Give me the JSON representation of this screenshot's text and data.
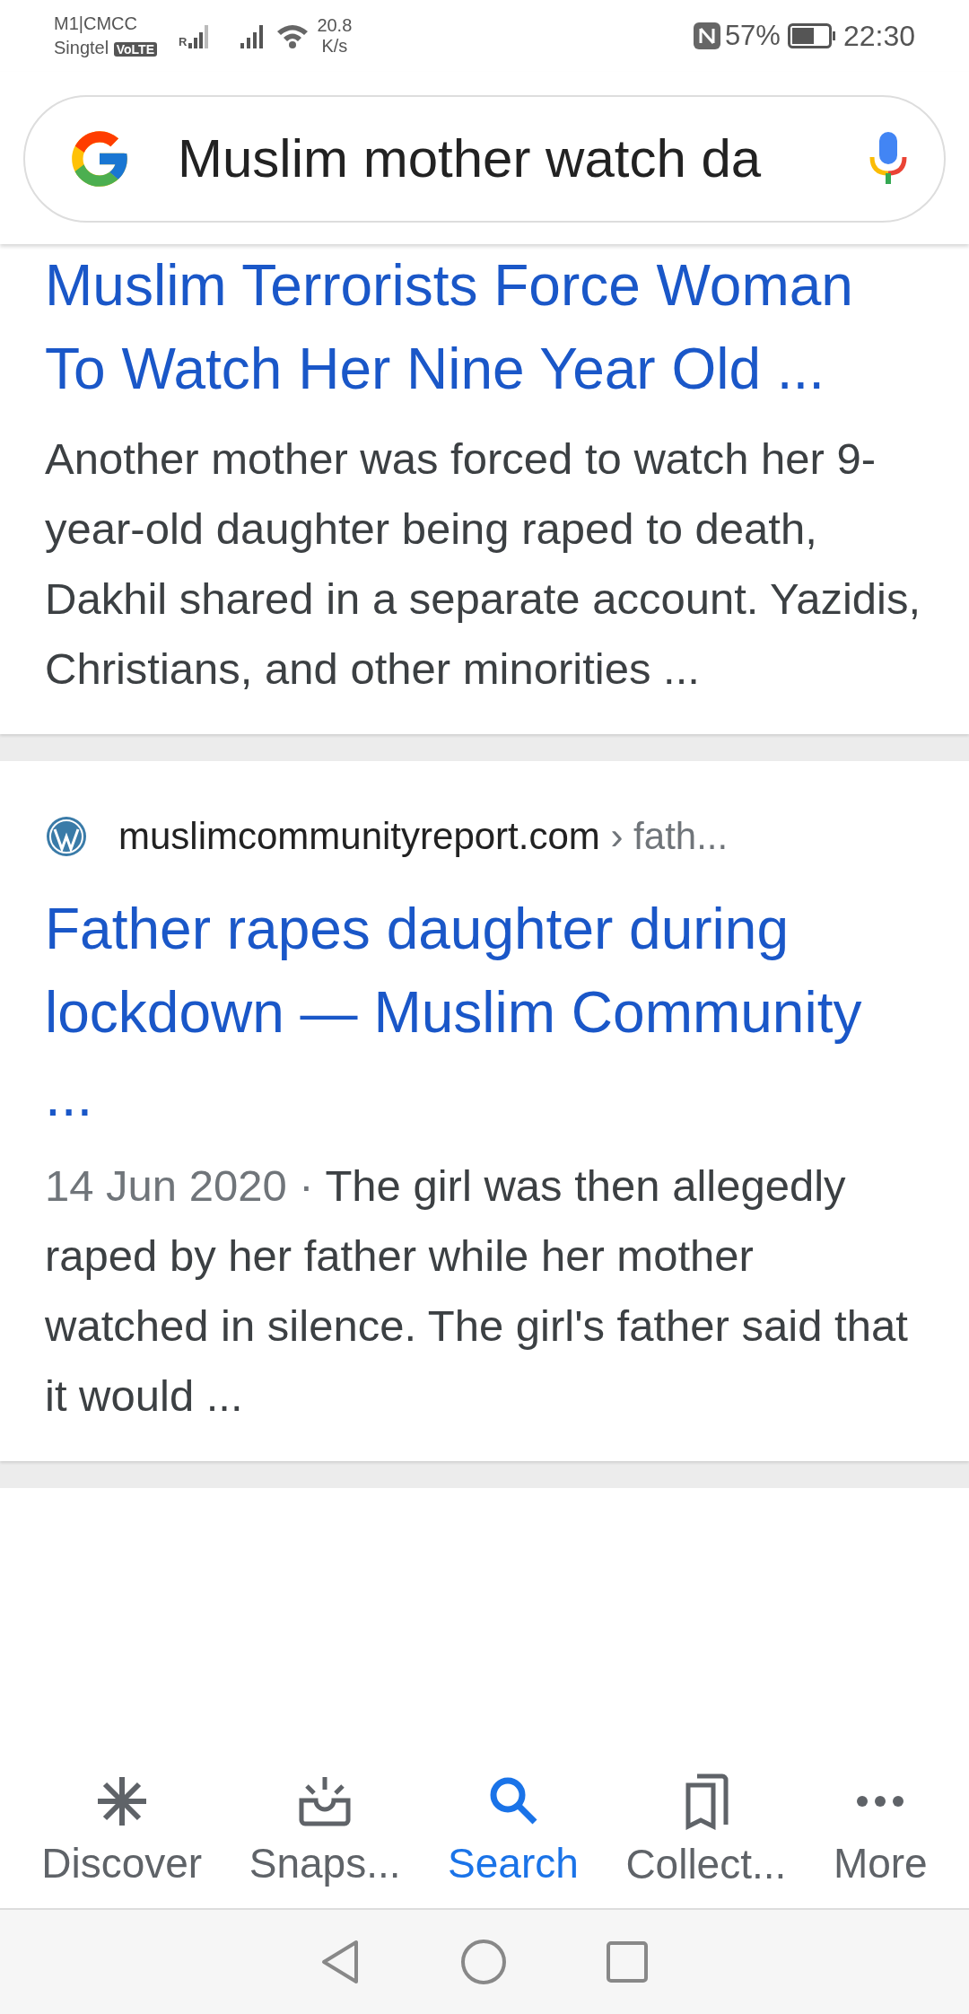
{
  "status_bar": {
    "carrier_1": "M1|CMCC",
    "carrier_2": "Singtel",
    "volte": "VoLTE",
    "roaming": "R",
    "speed_value": "20.8",
    "speed_unit": "K/s",
    "battery": "57%",
    "time": "22:30"
  },
  "search": {
    "value": "Muslim mother watch da"
  },
  "results": [
    {
      "kind": "plain",
      "title": "Muslim Terrorists Force Woman To Watch Her Nine Year Old ...",
      "snippet": "Another mother was forced to watch her 9-year-old daughter being raped to death, Dakhil shared in a separate account. Yazidis, Christians, and other minorities ..."
    },
    {
      "kind": "sourced",
      "site": "muslimcommunityreport.com",
      "path": "› fath...",
      "title": "Father rapes daughter during lockdown — Muslim Community ...",
      "date": "14 Jun 2020 ·",
      "snippet": "The girl was then allegedly raped by her father while her mother watched in silence. The girl's father said that it would ..."
    }
  ],
  "bottom_nav": [
    {
      "label": "Discover",
      "selected": false
    },
    {
      "label": "Snaps...",
      "selected": false
    },
    {
      "label": "Search",
      "selected": true
    },
    {
      "label": "Collect...",
      "selected": false
    },
    {
      "label": "More",
      "selected": false
    }
  ]
}
